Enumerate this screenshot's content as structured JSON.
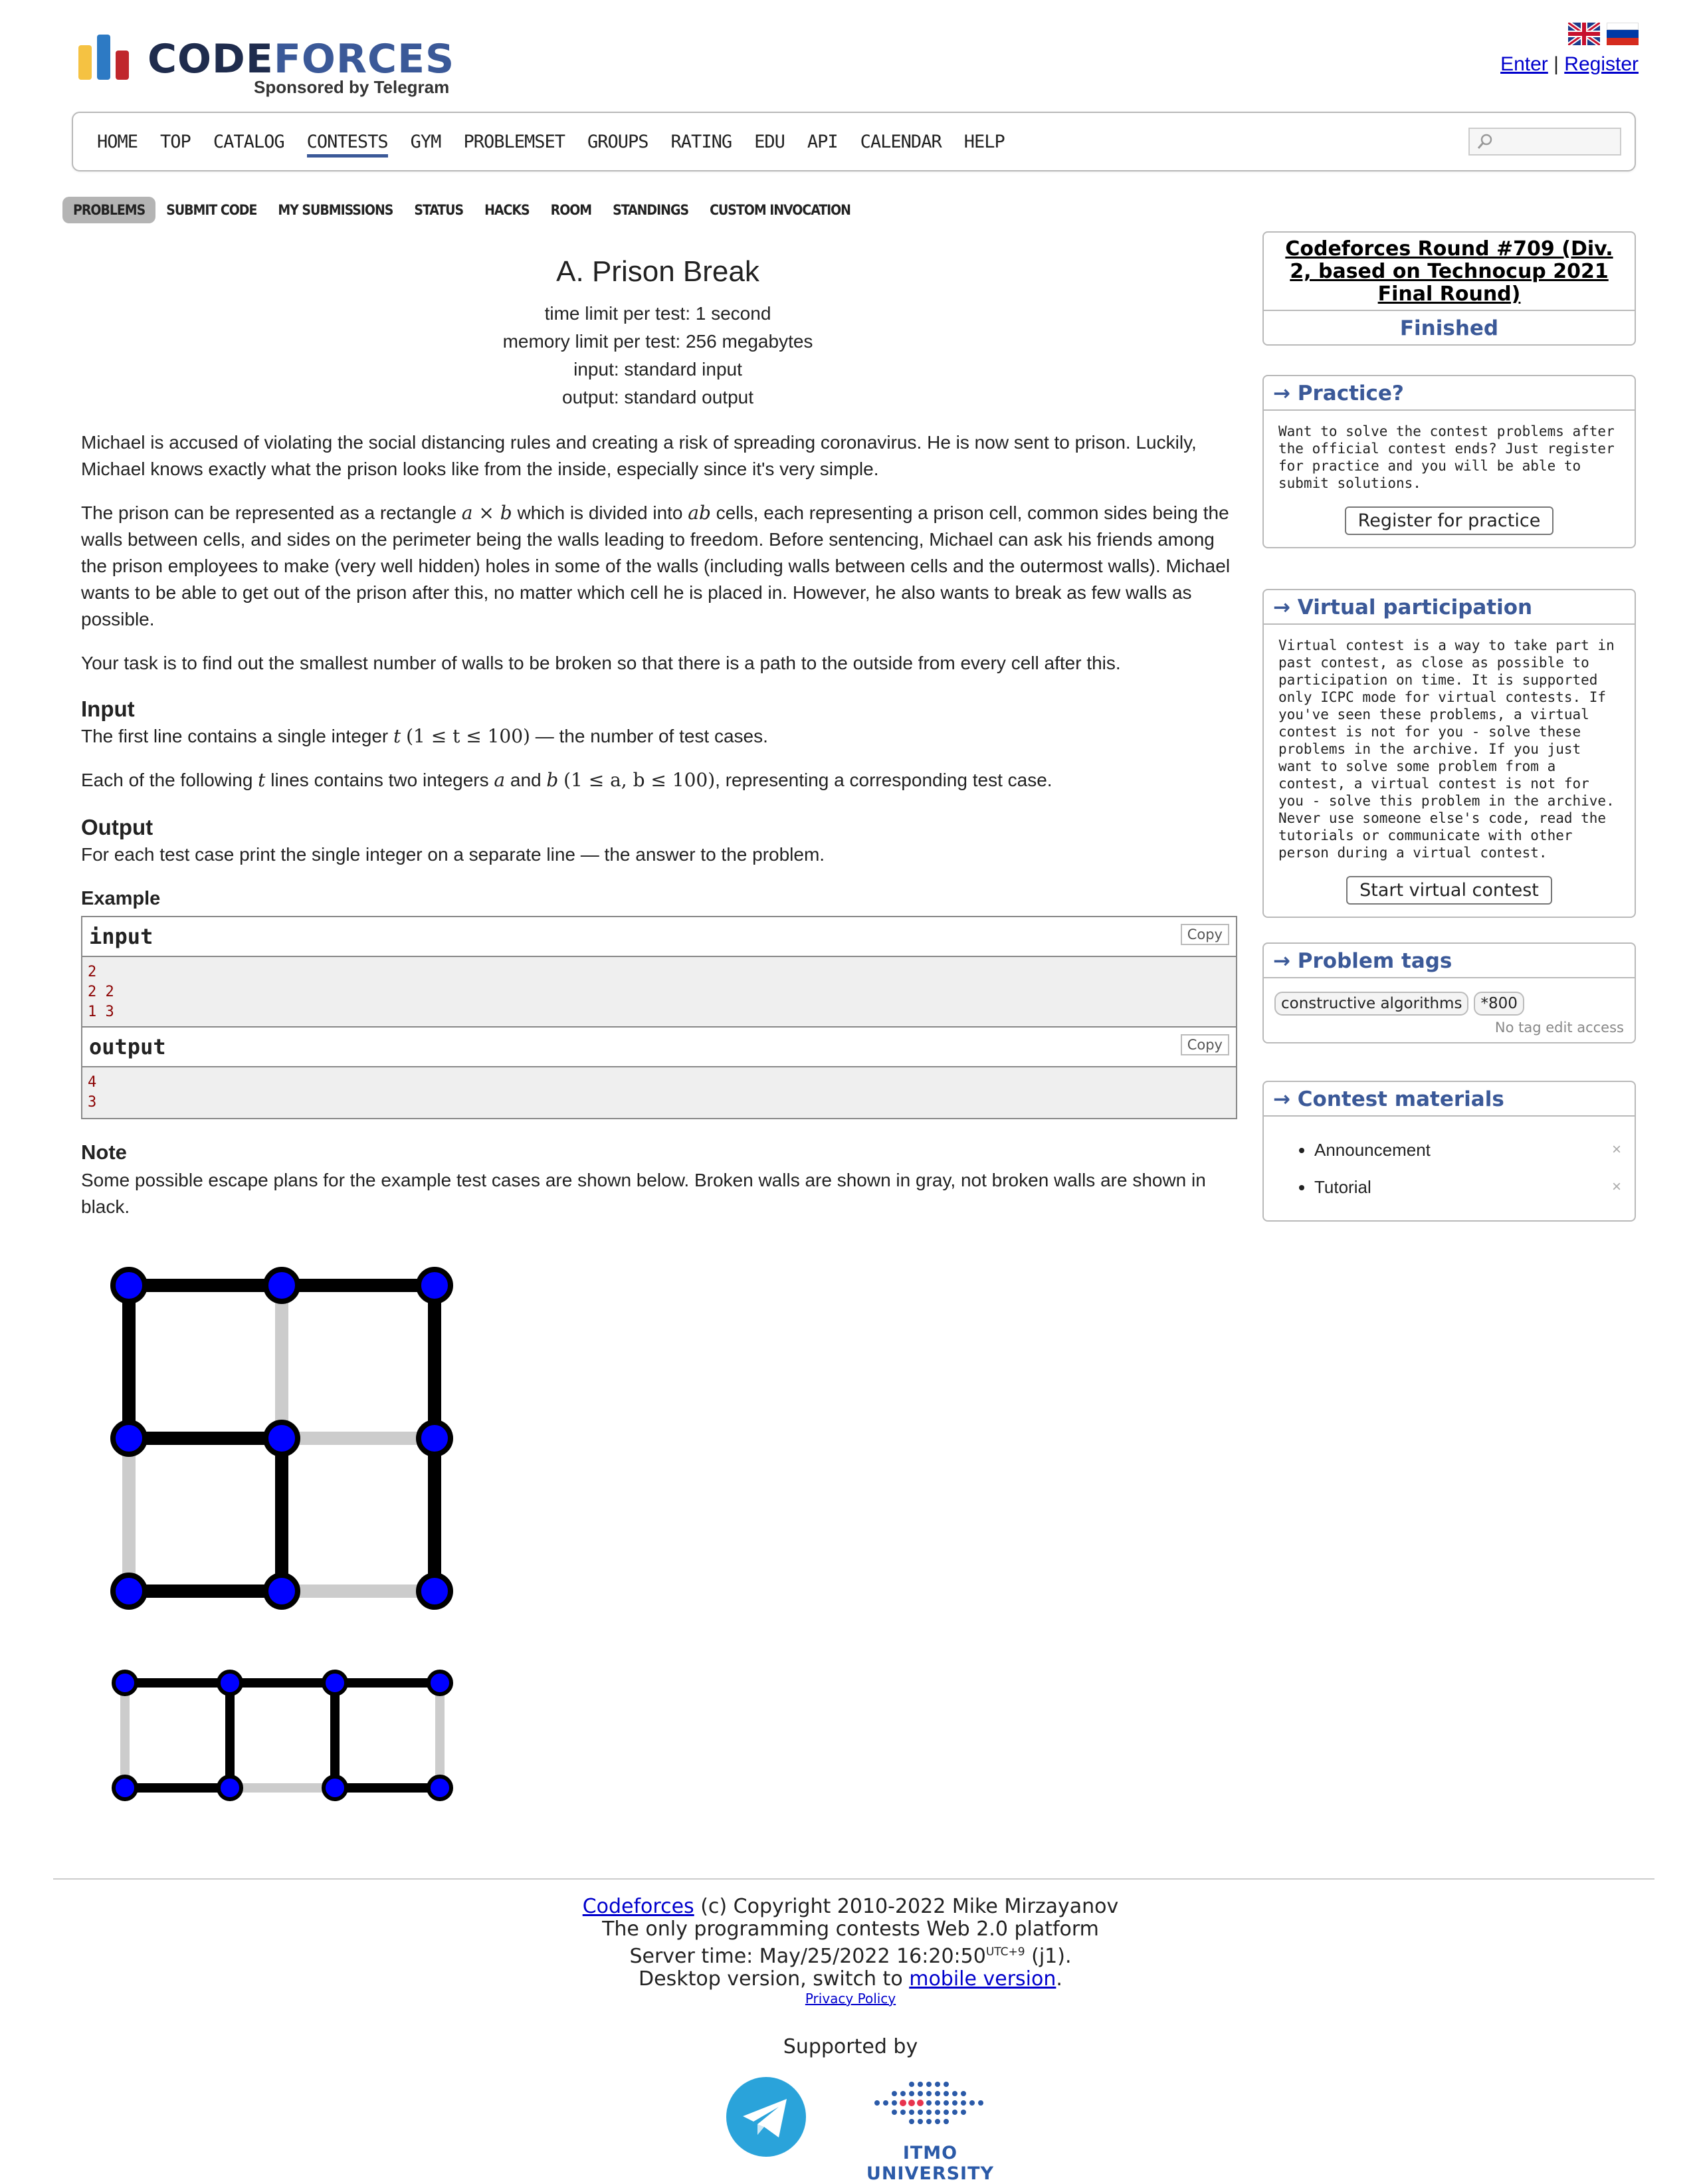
{
  "header": {
    "logo_text_code": "CODE",
    "logo_text_forces": "FORCES",
    "logo_sponsor": "Sponsored by Telegram",
    "enter": "Enter",
    "separator": "|",
    "register": "Register"
  },
  "menu": {
    "items": [
      "HOME",
      "TOP",
      "CATALOG",
      "CONTESTS",
      "GYM",
      "PROBLEMSET",
      "GROUPS",
      "RATING",
      "EDU",
      "API",
      "CALENDAR",
      "HELP"
    ],
    "active": "CONTESTS"
  },
  "tabs": [
    "PROBLEMS",
    "SUBMIT CODE",
    "MY SUBMISSIONS",
    "STATUS",
    "HACKS",
    "ROOM",
    "STANDINGS",
    "CUSTOM INVOCATION"
  ],
  "problem": {
    "title": "A. Prison Break",
    "time_limit": "time limit per test: 1 second",
    "memory_limit": "memory limit per test: 256 megabytes",
    "input": "input: standard input",
    "output": "output: standard output",
    "p1": "Michael is accused of violating the social distancing rules and creating a risk of spreading coronavirus. He is now sent to prison. Luckily, Michael knows exactly what the prison looks like from the inside, especially since it's very simple.",
    "p2_a": "The prison can be represented as a rectangle ",
    "p2_m1": "a × b",
    "p2_b": " which is divided into ",
    "p2_m2": "ab",
    "p2_c": " cells, each representing a prison cell, common sides being the walls between cells, and sides on the perimeter being the walls leading to freedom. Before sentencing, Michael can ask his friends among the prison employees to make (very well hidden) holes in some of the walls (including walls between cells and the outermost walls). Michael wants to be able to get out of the prison after this, no matter which cell he is placed in. However, he also wants to break as few walls as possible.",
    "p3": "Your task is to find out the smallest number of walls to be broken so that there is a path to the outside from every cell after this.",
    "input_h": "Input",
    "in1_a": "The first line contains a single integer ",
    "in1_m": "t",
    "in1_m2": "(1 ≤ t ≤ 100)",
    "in1_b": " — the number of test cases.",
    "in2_a": "Each of the following ",
    "in2_m": "t",
    "in2_b": " lines contains two integers ",
    "in2_m2": "a",
    "in2_c": " and ",
    "in2_m3": "b",
    "in2_m4": "(1 ≤ a, b ≤ 100)",
    "in2_d": ", representing a corresponding test case.",
    "output_h": "Output",
    "out1": "For each test case print the single integer on a separate line — the answer to the problem.",
    "example_h": "Example",
    "sample_input_label": "input",
    "sample_input": "2\n2 2\n1 3",
    "sample_output_label": "output",
    "sample_output": "4\n3",
    "copy": "Copy",
    "note_h": "Note",
    "note": "Some possible escape plans for the example test cases are shown below. Broken walls are shown in gray, not broken walls are shown in black."
  },
  "sidebar": {
    "contest_name": "Codeforces Round #709 (Div. 2, based on Technocup 2021 Final Round)",
    "contest_status": "Finished",
    "practice_title": "→ Practice?",
    "practice_text": "Want to solve the contest problems after the official contest ends? Just register for practice and you will be able to submit solutions.",
    "practice_button": "Register for practice",
    "virtual_title": "→ Virtual participation",
    "virtual_text": "Virtual contest is a way to take part in past contest, as close as possible to participation on time. It is supported only ICPC mode for virtual contests. If you've seen these problems, a virtual contest is not for you - solve these problems in the archive. If you just want to solve some problem from a contest, a virtual contest is not for you - solve this problem in the archive. Never use someone else's code, read the tutorials or communicate with other person during a virtual contest.",
    "virtual_button": "Start virtual contest",
    "tags_title": "→ Problem tags",
    "tags": [
      "constructive algorithms",
      "*800"
    ],
    "tags_note": "No tag edit access",
    "materials_title": "→ Contest materials",
    "materials": [
      "Announcement",
      "Tutorial"
    ]
  },
  "footer": {
    "codeforces": "Codeforces",
    "copyright": " (c) Copyright 2010-2022 Mike Mirzayanov",
    "line2": "The only programming contests Web 2.0 platform",
    "server_a": "Server time: May/25/2022 16:20:50",
    "server_tz": "UTC+9",
    "server_b": " (j1).",
    "desktop_a": "Desktop version, switch to ",
    "mobile": "mobile version",
    "desktop_b": ".",
    "privacy": "Privacy Policy",
    "supported": "Supported by",
    "itmo": "ITMO UNIVERSITY"
  },
  "colors": {
    "brand_blue": "#3b5998",
    "link": "#0000cc",
    "node_blue": "#0000ff",
    "broken_wall": "#cccccc",
    "wall": "#000000"
  }
}
